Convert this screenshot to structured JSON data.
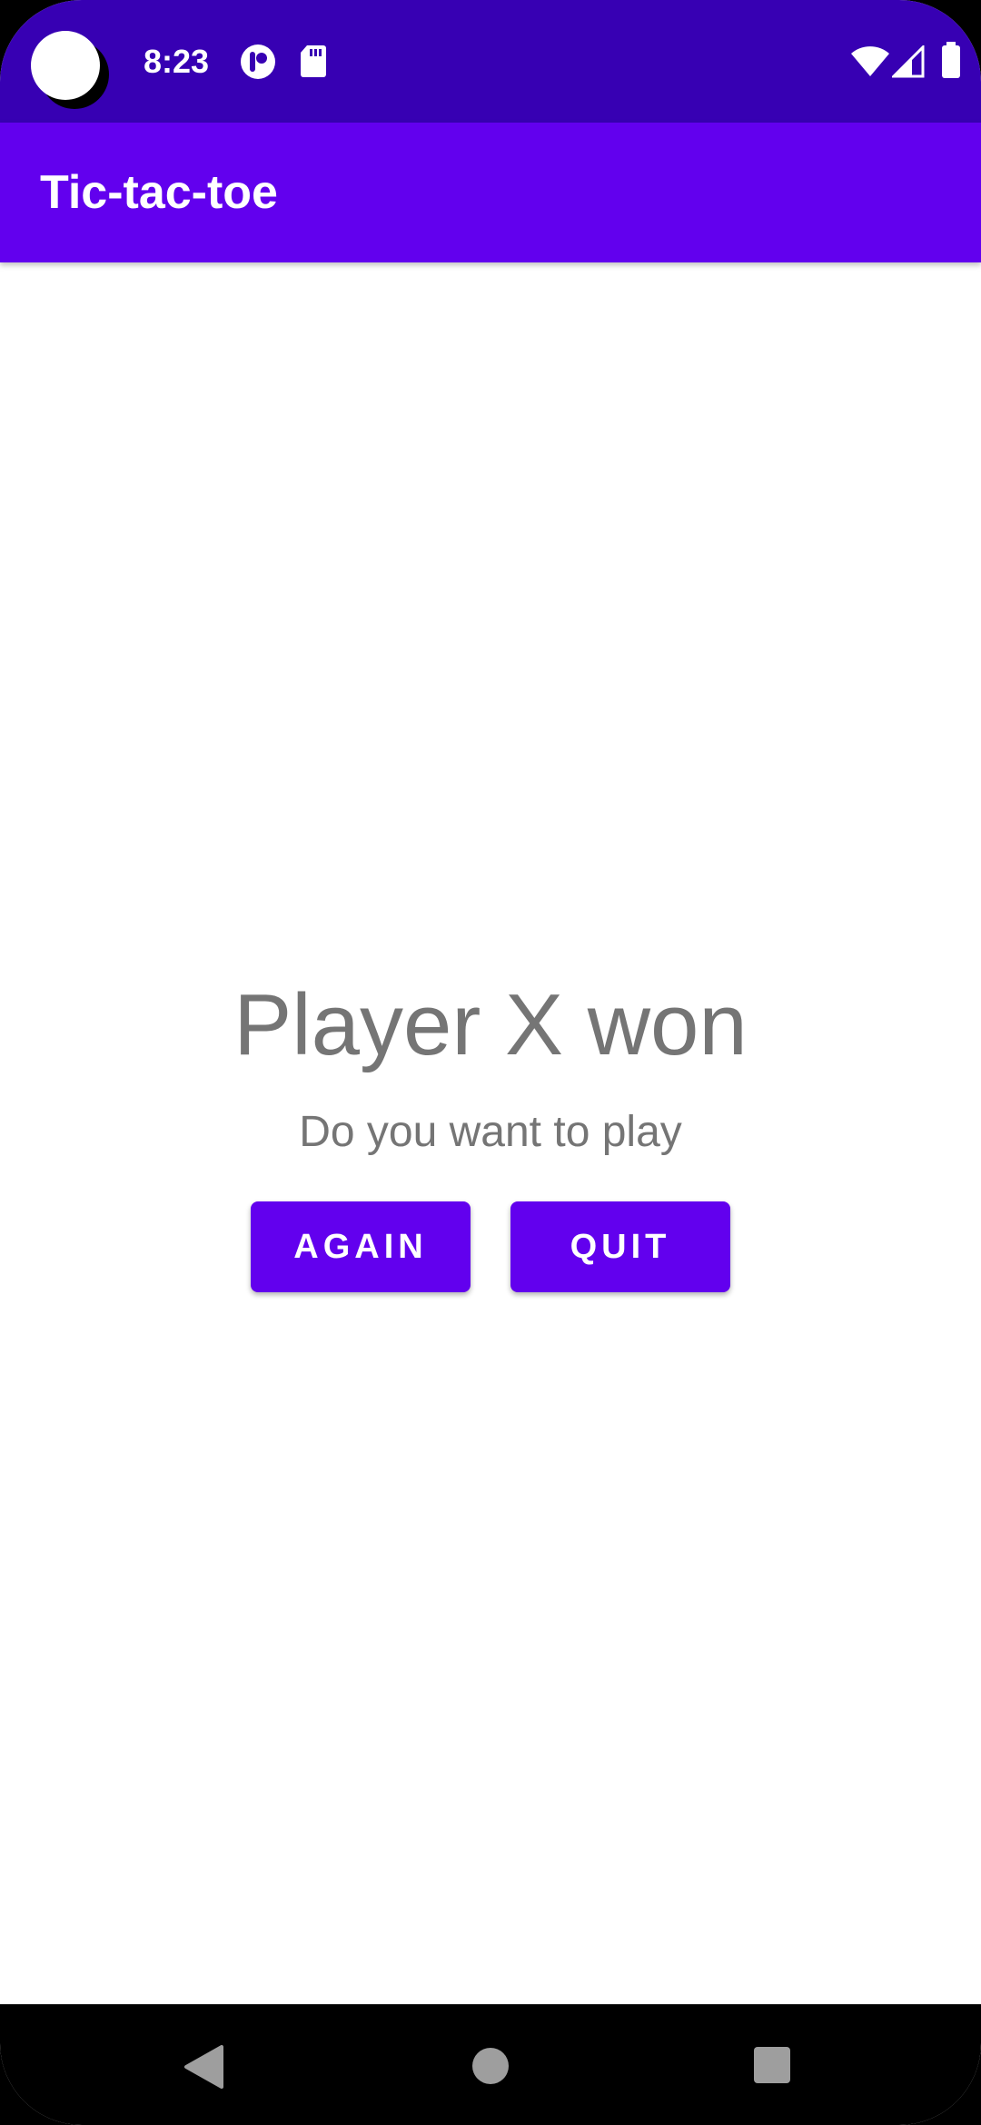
{
  "status_bar": {
    "time": "8:23",
    "icons": [
      "camera-hole",
      "app-notification-icon",
      "sd-card-icon",
      "wifi-icon",
      "cellular-signal-icon",
      "battery-icon"
    ]
  },
  "app_bar": {
    "title": "Tic-tac-toe"
  },
  "main": {
    "result_title": "Player X won",
    "prompt": "Do you want to play",
    "again_label": "AGAIN",
    "quit_label": "QUIT"
  },
  "nav_bar": {
    "icons": [
      "back-icon",
      "home-icon",
      "recents-icon"
    ]
  },
  "colors": {
    "status_bar": "#3700b3",
    "app_bar": "#6200ee",
    "button": "#6200ee",
    "text_secondary": "#757575"
  }
}
